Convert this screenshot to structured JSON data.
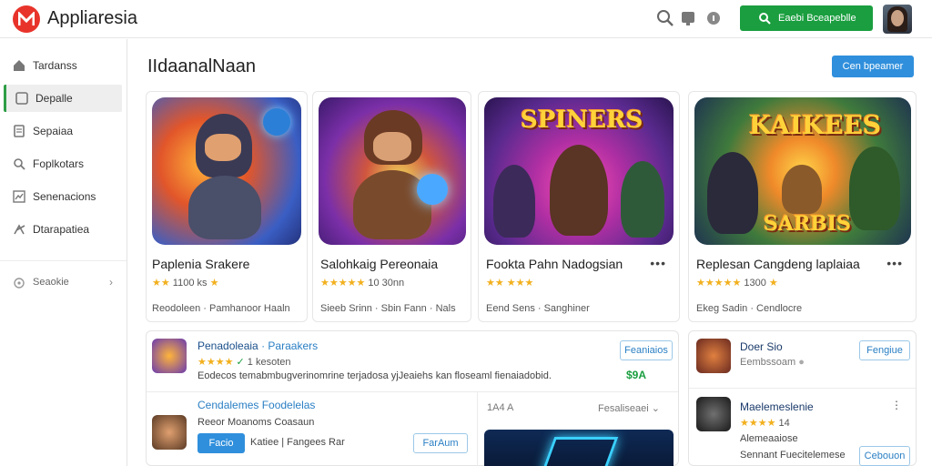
{
  "app": {
    "title": "Appliaresia"
  },
  "header": {
    "search_label": "Eaebi Bceapeblle"
  },
  "sidebar": {
    "items": [
      {
        "label": "Tardanss",
        "icon": "home-icon"
      },
      {
        "label": "Depalle",
        "icon": "apps-icon"
      },
      {
        "label": "Sepaiaa",
        "icon": "document-icon"
      },
      {
        "label": "Foplkotars",
        "icon": "search-icon"
      },
      {
        "label": "Senenacions",
        "icon": "chart-icon"
      },
      {
        "label": "Dtarapatiea",
        "icon": "share-icon"
      }
    ],
    "footer_item": {
      "label": "Seaokie",
      "icon": "settings-icon"
    }
  },
  "main": {
    "title": "IIdaanalNaan",
    "primary_button": "Cen bpeamer"
  },
  "cards": [
    {
      "name": "Paplenia Srakere",
      "rating": "1100 ks",
      "sub": "Reodoleen · Pamhanoor Haaln",
      "art_text": ""
    },
    {
      "name": "Salohkaig Pereonaia",
      "rating": "10 30nn",
      "sub": "Sieeb Srinn · Sbin Fann · Nals",
      "art_text": ""
    },
    {
      "name": "Fookta Pahn Nadogsian",
      "rating": "",
      "sub": "Eend Sens · Sanghiner",
      "art_text": "SPINERS"
    },
    {
      "name": "Replesan Cangdeng laplaiaa",
      "rating": "1300",
      "sub": "Ekeg Sadin · Cendlocre",
      "art_text": "KAIKEES",
      "art_text2": "SARBIS"
    }
  ],
  "list_left": {
    "item1": {
      "title": "Penadoleaia",
      "tag": "Paraakers",
      "rating": "1 kesoten",
      "desc": "Eodecos temabmbugverinomrine terjadosa yjJeaiehs kan floseaml fienaiadobid.",
      "button": "Feaniaios",
      "price": "$9A"
    },
    "item2": {
      "title": "Cendalemes Foodelelas",
      "text": "Reeor Moanoms Coasaun",
      "button_primary": "Facio",
      "link": "Katiee | Fangees Rar",
      "button_secondary": "FarAum"
    },
    "preview": {
      "left_label": "1A4 A",
      "right_label": "Fesaliseaei"
    }
  },
  "list_right": {
    "item1": {
      "title": "Doer Sio",
      "text": "Eembssoam",
      "button": "Fengiue"
    },
    "item2": {
      "title": "Maelemeslenie",
      "rating": "14",
      "text": "Alemeaaiose",
      "text2": "Sennant Fuecitelemese",
      "button": "Cebouon"
    }
  }
}
